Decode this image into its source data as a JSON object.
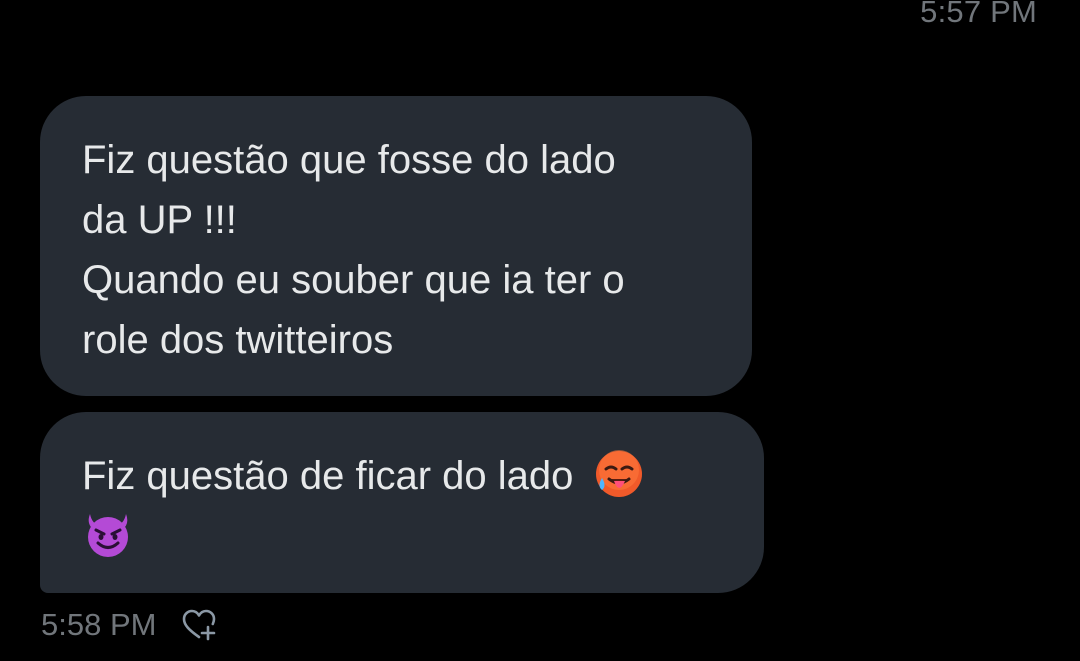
{
  "header": {
    "timestamp": "5:57 PM"
  },
  "messages": [
    {
      "lines": [
        "Fiz questão que fosse do lado",
        "da UP !!!",
        "Quando eu souber que ia ter o",
        "role dos twitteiros"
      ]
    },
    {
      "line1_text": "Fiz questão de ficar do lado",
      "emojis": [
        "hot-face-emoji",
        "smiling-devil-emoji"
      ]
    }
  ],
  "footer": {
    "timestamp": "5:58 PM",
    "react_icon": "heart-plus-icon"
  },
  "colors": {
    "background": "#000000",
    "bubble": "#262c34",
    "text": "#e7e9ea",
    "muted": "#71767b"
  }
}
